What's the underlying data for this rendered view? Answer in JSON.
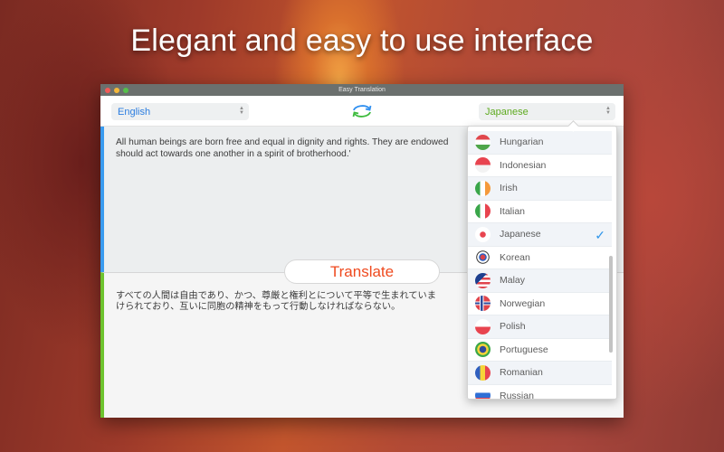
{
  "headline": "Elegant and easy to use interface",
  "window": {
    "title": "Easy Translation",
    "controls": [
      "close",
      "minimize",
      "maximize"
    ]
  },
  "toolbar": {
    "source_language": "English",
    "target_language": "Japanese",
    "swap_icon": "swap-arrows-icon"
  },
  "source_text": "All human beings are born free and equal in dignity and rights. They are endowed\nshould act towards one another in a spirit of brotherhood.'",
  "translate_button": "Translate",
  "translated_text": "すべての人間は自由であり、かつ、尊厳と権利とについて平等で生まれていま\nけられており、互いに同胞の精神をもって行動しなければならない。",
  "dropdown": {
    "selected": "Japanese",
    "items": [
      {
        "label": "Hungarian",
        "flag": "hungary-flag-icon"
      },
      {
        "label": "Indonesian",
        "flag": "indonesia-flag-icon"
      },
      {
        "label": "Irish",
        "flag": "ireland-flag-icon"
      },
      {
        "label": "Italian",
        "flag": "italy-flag-icon"
      },
      {
        "label": "Japanese",
        "flag": "japan-flag-icon",
        "checked": true
      },
      {
        "label": "Korean",
        "flag": "korea-flag-icon"
      },
      {
        "label": "Malay",
        "flag": "malaysia-flag-icon"
      },
      {
        "label": "Norwegian",
        "flag": "norway-flag-icon"
      },
      {
        "label": "Polish",
        "flag": "poland-flag-icon"
      },
      {
        "label": "Portuguese",
        "flag": "brazil-flag-icon"
      },
      {
        "label": "Romanian",
        "flag": "romania-flag-icon"
      },
      {
        "label": "Russian",
        "flag": "russia-flag-icon"
      }
    ]
  },
  "colors": {
    "source_accent": "#3a9bef",
    "target_accent": "#6ec32e",
    "translate_text": "#ef4a1f",
    "source_lang_text": "#2b7de0",
    "target_lang_text": "#5eaa1f",
    "checkmark": "#2f95ea"
  }
}
